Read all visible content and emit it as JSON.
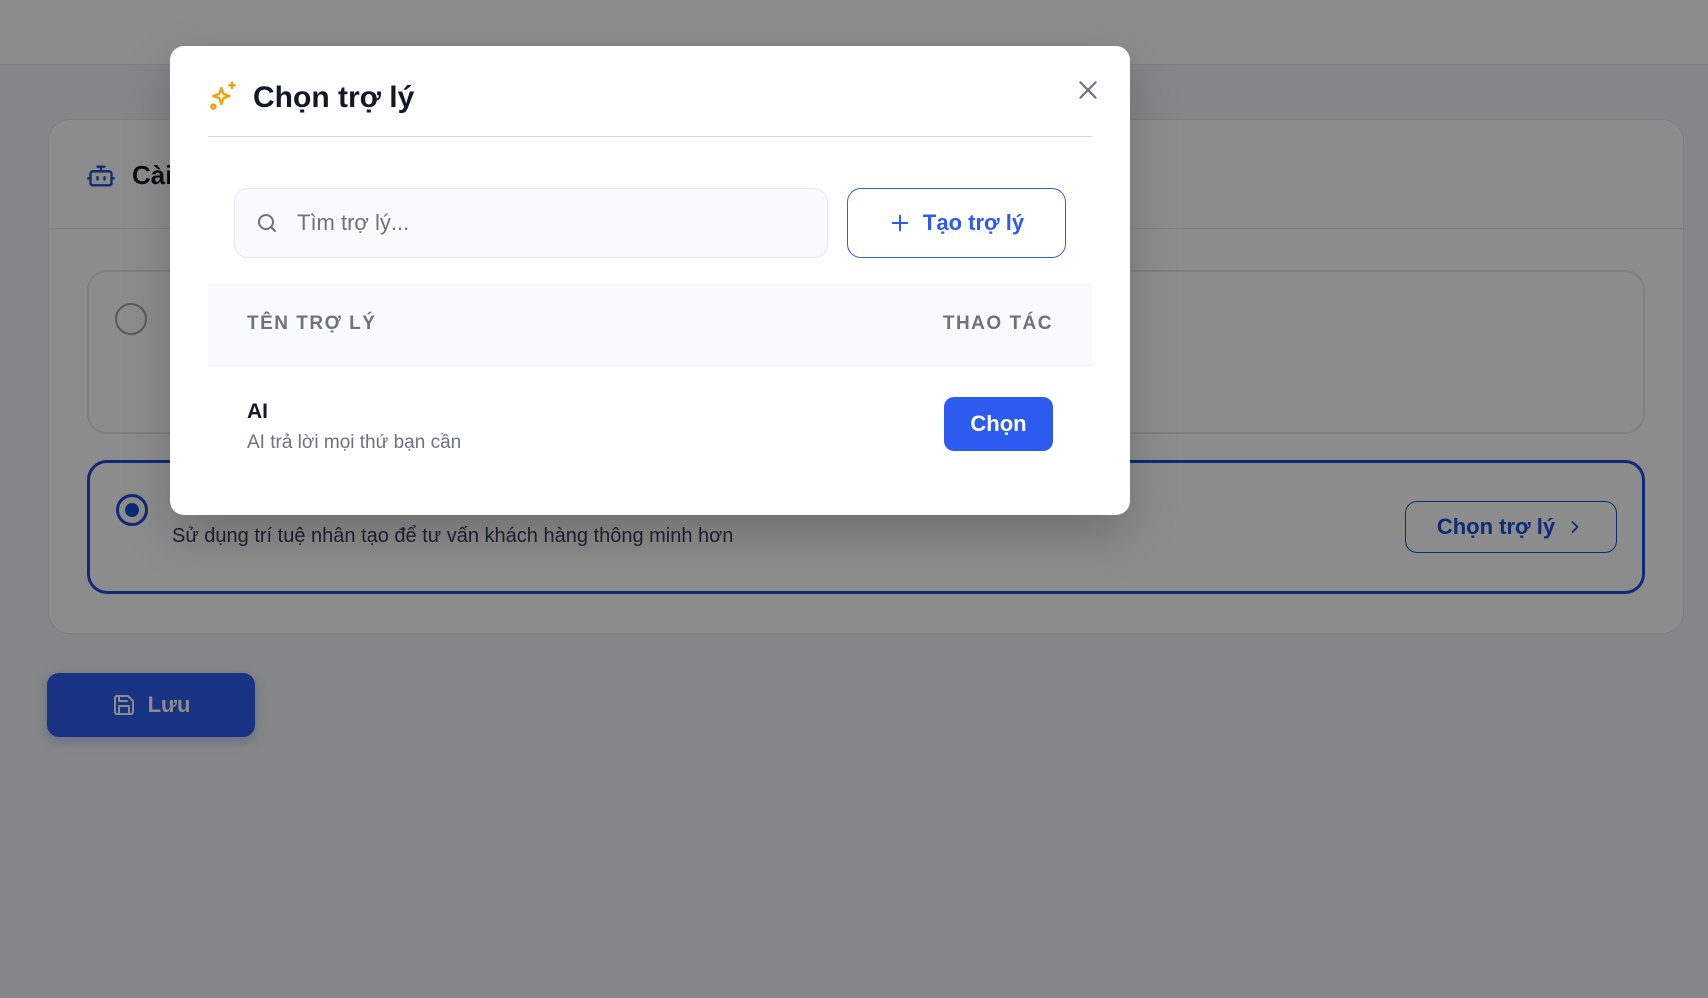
{
  "background": {
    "card_title": "Cài",
    "option2_desc": "Sử dụng trí tuệ nhân tạo để tư vấn khách hàng thông minh hơn",
    "choose_button_label": "Chọn trợ lý",
    "save_button_label": "Lưu"
  },
  "modal": {
    "title": "Chọn trợ lý",
    "search": {
      "placeholder": "Tìm trợ lý...",
      "value": ""
    },
    "create_button_label": "Tạo trợ lý",
    "table": {
      "columns": {
        "name": "TÊN TRỢ LÝ",
        "action": "THAO TÁC"
      },
      "rows": [
        {
          "name": "AI",
          "description": "AI trả lời mọi thứ bạn cần",
          "action_label": "Chọn"
        }
      ]
    }
  },
  "colors": {
    "primary": "#2d5bf0",
    "primary_dark": "#1d4ed8",
    "sparkle": "#f59e0b",
    "overlay": "rgba(0,0,0,0.45)"
  },
  "icons": [
    "robot-icon",
    "sparkle-icon",
    "close-icon",
    "search-icon",
    "plus-icon",
    "chevron-right-icon",
    "save-icon"
  ]
}
